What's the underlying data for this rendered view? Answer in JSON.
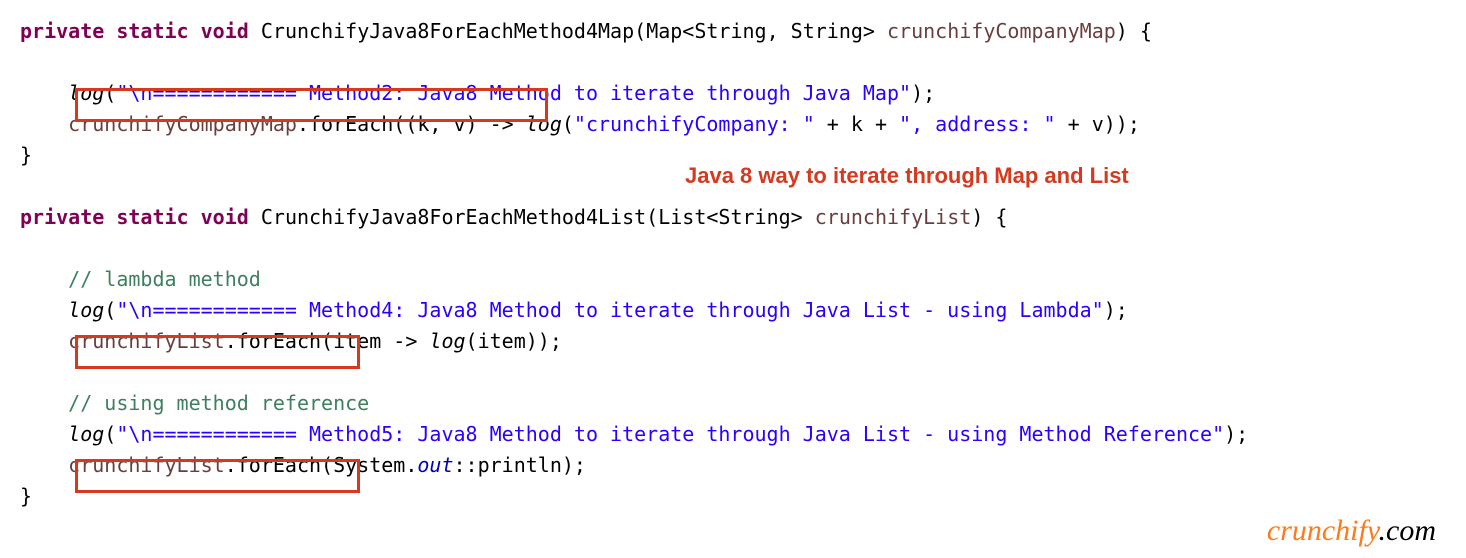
{
  "code": {
    "l1": {
      "kw1": "private",
      "kw2": "static",
      "kw3": "void",
      "name": "CrunchifyJava8ForEachMethod4Map",
      "gen": "Map<String, String>",
      "param": "crunchifyCompanyMap",
      "brace": " {"
    },
    "l2": {
      "log": "log",
      "str": "\"\\n============ Method2: Java8 Method to iterate through Java Map\"",
      "end": ");"
    },
    "l3": {
      "map": "crunchifyCompanyMap",
      "forEach": ".forEach((k, v)",
      "arrow": " -> ",
      "log": "log",
      "str1": "\"crunchifyCompany: \"",
      "plus1": " + k + ",
      "str2": "\", address: \"",
      "plus2": " + v));"
    },
    "l4": {
      "brace": "}"
    },
    "l5": {
      "kw1": "private",
      "kw2": "static",
      "kw3": "void",
      "name": "CrunchifyJava8ForEachMethod4List",
      "gen": "List<String>",
      "param": "crunchifyList",
      "brace": " {"
    },
    "l6": {
      "cmt": "// lambda method"
    },
    "l7": {
      "log": "log",
      "str": "\"\\n============ Method4: Java8 Method to iterate through Java List - using Lambda\"",
      "end": ");"
    },
    "l8": {
      "list": "crunchifyList",
      "forEach": ".forEach",
      "lambda": "(item -> ",
      "log": "log",
      "tail": "(item));"
    },
    "l9": {
      "cmt": "// using method reference"
    },
    "l10": {
      "log": "log",
      "str": "\"\\n============ Method5: Java8 Method to iterate through Java List - using Method Reference\"",
      "end": ");"
    },
    "l11": {
      "list": "crunchifyList",
      "forEach": ".forEach",
      "open": "(System.",
      "out": "out",
      "tail": "::println);"
    },
    "l12": {
      "brace": "}"
    }
  },
  "annotation": "Java 8 way to iterate through Map and List",
  "watermark": {
    "brand": "crunchify",
    "suffix": ".com"
  }
}
